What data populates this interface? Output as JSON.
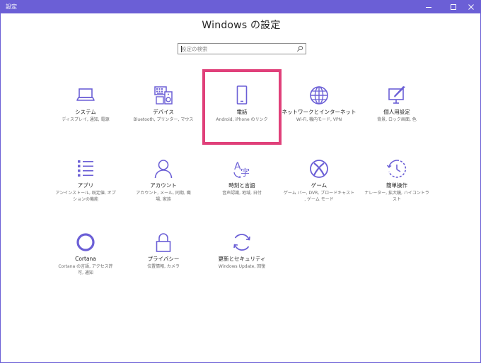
{
  "window": {
    "title": "設定",
    "controls": [
      "minimize-icon",
      "maximize-icon",
      "close-icon"
    ]
  },
  "heading": "Windows の設定",
  "search": {
    "placeholder": "設定の検索",
    "value": "",
    "icon": "search-icon"
  },
  "accent_color": "#6b5fd6",
  "highlight_color": "#e0407a",
  "tiles": [
    {
      "id": "system",
      "icon": "laptop-icon",
      "label": "システム",
      "desc": "ディスプレイ, 通知, 電源"
    },
    {
      "id": "devices",
      "icon": "devices-icon",
      "label": "デバイス",
      "desc": "Bluetooth, プリンター, マウス"
    },
    {
      "id": "phone",
      "icon": "phone-icon",
      "label": "電話",
      "desc": "Android, iPhone のリンク",
      "highlighted": true
    },
    {
      "id": "network",
      "icon": "globe-icon",
      "label": "ネットワークとインターネット",
      "desc": "Wi-Fi, 機内モード, VPN"
    },
    {
      "id": "personalization",
      "icon": "personalization-icon",
      "label": "個人用設定",
      "desc": "背景, ロック画面, 色"
    },
    {
      "id": "apps",
      "icon": "apps-list-icon",
      "label": "アプリ",
      "desc": "アンインストール, 既定値, オプ\nションの機能"
    },
    {
      "id": "accounts",
      "icon": "person-icon",
      "label": "アカウント",
      "desc": "アカウント, メール, 同期, 職\n場, 家族"
    },
    {
      "id": "time-language",
      "icon": "time-language-icon",
      "label": "時刻と言語",
      "desc": "音声認識, 地域, 日付"
    },
    {
      "id": "gaming",
      "icon": "xbox-icon",
      "label": "ゲーム",
      "desc": "ゲーム バー, DVR, ブロードキャスト\n, ゲーム モード"
    },
    {
      "id": "ease-of-access",
      "icon": "ease-of-access-icon",
      "label": "簡単操作",
      "desc": "ナレーター, 拡大鏡, ハイコントラ\nスト"
    },
    {
      "id": "cortana",
      "icon": "cortana-icon",
      "label": "Cortana",
      "desc": "Cortana の言語, アクセス許\n可, 通知"
    },
    {
      "id": "privacy",
      "icon": "lock-icon",
      "label": "プライバシー",
      "desc": "位置情報, カメラ"
    },
    {
      "id": "update-security",
      "icon": "sync-icon",
      "label": "更新とセキュリティ",
      "desc": "Windows Update, 回復"
    }
  ]
}
